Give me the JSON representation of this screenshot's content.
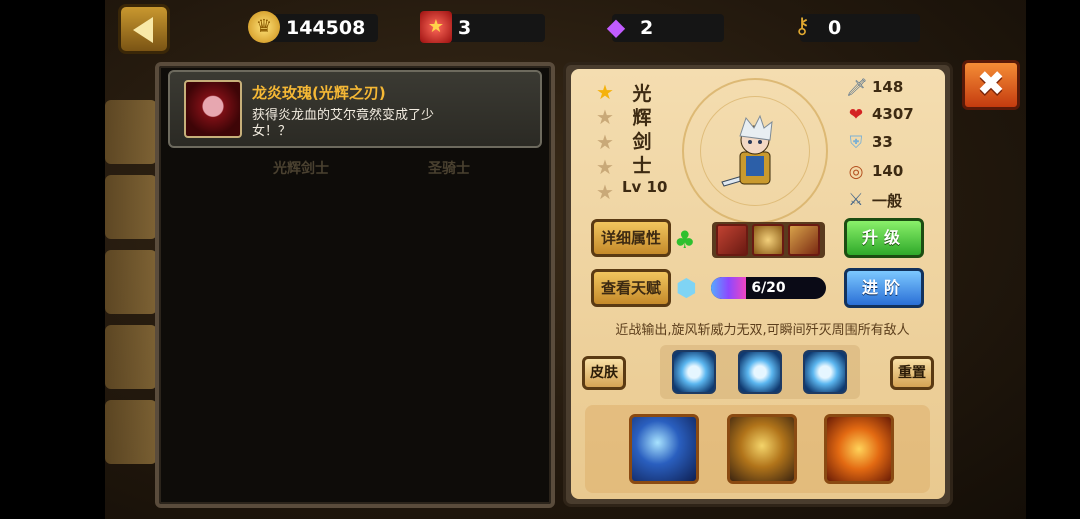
{
  "resources": {
    "gold": "144508",
    "red_item": "3",
    "gem": "2",
    "key": "0"
  },
  "tooltip": {
    "title": "龙炎玫瑰(光辉之刃)",
    "description": "获得炎龙血的艾尔竟然变成了少女！？"
  },
  "background_labels": [
    "光辉剑士",
    "圣骑士"
  ],
  "hero": {
    "name_chars": [
      "光",
      "辉",
      "剑",
      "士"
    ],
    "stars_total": 5,
    "stars_filled": 1,
    "level": "Lv 10"
  },
  "stats": {
    "attack": "148",
    "hp": "4307",
    "defense": "33",
    "speed": "140",
    "quality": "一般"
  },
  "buttons": {
    "details": "详细属性",
    "talent": "查看天赋",
    "upgrade": "升级",
    "advance": "进阶",
    "skin": "皮肤",
    "reset": "重置",
    "close_icon": "✖"
  },
  "progress": {
    "text": "6/20",
    "fraction": 0.3
  },
  "skill_description": "近战输出,旋风斩威力无双,可瞬间歼灭周围所有敌人",
  "icons": {
    "gold": "gold-coin-icon",
    "red_item": "red-box-icon",
    "gem": "purple-gem-icon",
    "key": "key-icon",
    "attack": "sword-icon",
    "hp": "heart-icon",
    "defense": "armor-icon",
    "speed": "target-icon",
    "quality": "crossed-swords-icon",
    "clover": "clover-icon",
    "crystal": "crystal-icon"
  },
  "colors": {
    "title_orange": "#f5b835",
    "upgrade_green": "#2fa92a",
    "advance_blue": "#2a6fd6",
    "close_orange": "#e2601f"
  }
}
